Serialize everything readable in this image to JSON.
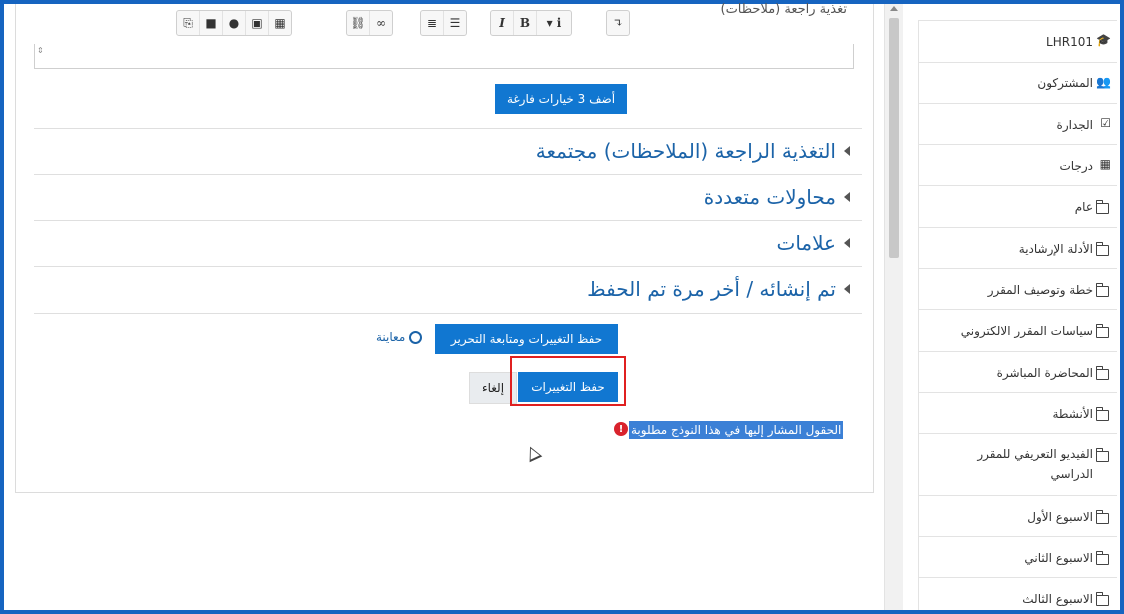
{
  "editor": {
    "partial_label": "(تغذية راجعة (ملاحظات",
    "toolbar_groups": [
      [
        "⎘",
        "■",
        "●",
        "▣",
        "▦"
      ],
      [
        "⛓",
        "∞"
      ],
      [
        "≣",
        "☰"
      ],
      [
        "I",
        "B",
        "▾ i"
      ],
      [
        "↴"
      ]
    ]
  },
  "buttons": {
    "add_choices": "أضف 3 خيارات فارغة",
    "save_continue": "حفظ التغييرات ومتابعة التحرير",
    "preview": "معاينة",
    "save": "حفظ التغييرات",
    "cancel": "إلغاء"
  },
  "sections": [
    "التغذية الراجعة (الملاحظات) مجتمعة",
    "محاولات متعددة",
    "علامات",
    "تم إنشائه / أخر مرة تم الحفظ"
  ],
  "required_note": "الحقول المشار إليها في هذا النوذج مطلوبة",
  "sidebar": {
    "items": [
      {
        "label": "LHR101",
        "icon": "graduation-cap-icon"
      },
      {
        "label": "المشتركون",
        "icon": "users-icon"
      },
      {
        "label": "الجدارة",
        "icon": "check-square-icon"
      },
      {
        "label": "درجات",
        "icon": "table-icon"
      },
      {
        "label": "عام",
        "icon": "folder-icon"
      },
      {
        "label": "الأدلة الإرشادية",
        "icon": "folder-icon"
      },
      {
        "label": "خطة وتوصيف المقرر",
        "icon": "folder-icon"
      },
      {
        "label": "سياسات المقرر الالكتروني",
        "icon": "folder-icon"
      },
      {
        "label": "المحاضرة المباشرة",
        "icon": "folder-icon"
      },
      {
        "label": "الأنشطة",
        "icon": "folder-icon"
      },
      {
        "label": "الفيديو التعريفي للمقرر الدراسي",
        "icon": "folder-icon"
      },
      {
        "label": "الاسبوع الأول",
        "icon": "folder-icon"
      },
      {
        "label": "الاسبوع الثاني",
        "icon": "folder-icon"
      },
      {
        "label": "الاسبوع الثالث",
        "icon": "folder-icon"
      }
    ]
  },
  "colors": {
    "primary": "#1177d1",
    "link": "#1b63a8",
    "frame": "#1664c0",
    "highlight": "#e02020"
  }
}
